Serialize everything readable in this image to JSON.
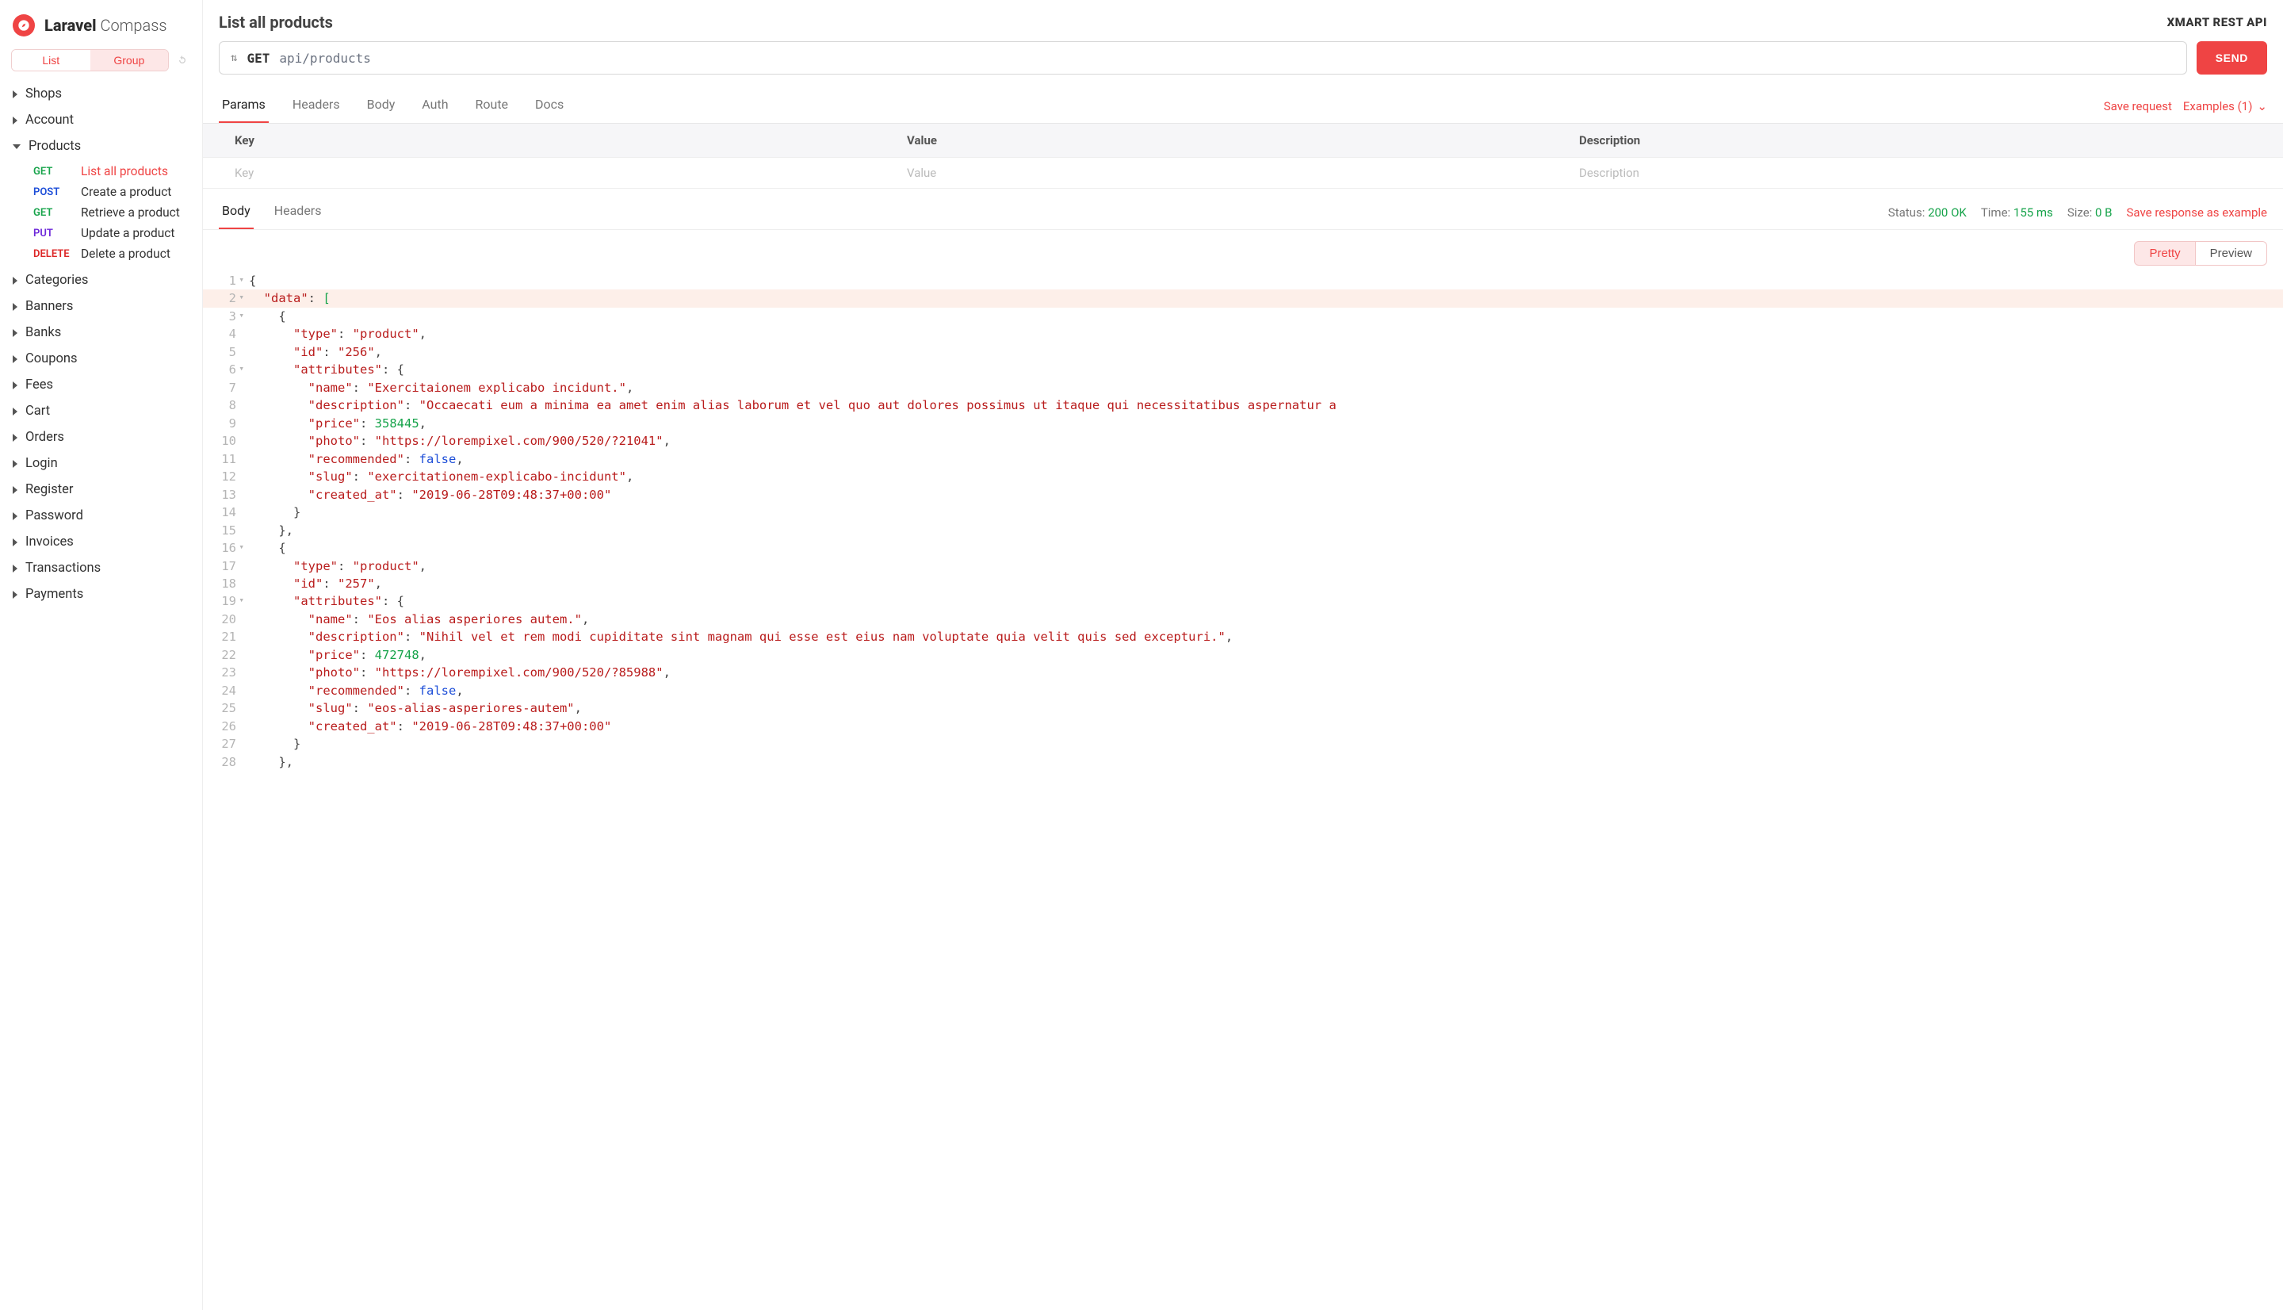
{
  "brand": {
    "bold": "Laravel",
    "light": "Compass"
  },
  "sidebarToggle": {
    "list": "List",
    "group": "Group"
  },
  "sidebar": {
    "groups": [
      {
        "label": "Shops",
        "expanded": false
      },
      {
        "label": "Account",
        "expanded": false
      },
      {
        "label": "Products",
        "expanded": true,
        "items": [
          {
            "method": "GET",
            "label": "List all products",
            "active": true
          },
          {
            "method": "POST",
            "label": "Create a product",
            "active": false
          },
          {
            "method": "GET",
            "label": "Retrieve a product",
            "active": false
          },
          {
            "method": "PUT",
            "label": "Update a product",
            "active": false
          },
          {
            "method": "DELETE",
            "label": "Delete a product",
            "active": false
          }
        ]
      },
      {
        "label": "Categories",
        "expanded": false
      },
      {
        "label": "Banners",
        "expanded": false
      },
      {
        "label": "Banks",
        "expanded": false
      },
      {
        "label": "Coupons",
        "expanded": false
      },
      {
        "label": "Fees",
        "expanded": false
      },
      {
        "label": "Cart",
        "expanded": false
      },
      {
        "label": "Orders",
        "expanded": false
      },
      {
        "label": "Login",
        "expanded": false
      },
      {
        "label": "Register",
        "expanded": false
      },
      {
        "label": "Password",
        "expanded": false
      },
      {
        "label": "Invoices",
        "expanded": false
      },
      {
        "label": "Transactions",
        "expanded": false
      },
      {
        "label": "Payments",
        "expanded": false
      }
    ]
  },
  "page": {
    "title": "List all products",
    "apiName": "XMART REST API"
  },
  "request": {
    "method": "GET",
    "url": "api/products",
    "send": "SEND"
  },
  "reqTabs": {
    "items": [
      "Params",
      "Headers",
      "Body",
      "Auth",
      "Route",
      "Docs"
    ],
    "active": "Params",
    "save": "Save request",
    "examples": "Examples (1)"
  },
  "kv": {
    "headers": {
      "key": "Key",
      "value": "Value",
      "desc": "Description"
    },
    "placeholders": {
      "key": "Key",
      "value": "Value",
      "desc": "Description"
    }
  },
  "respTabs": {
    "items": [
      "Body",
      "Headers"
    ],
    "active": "Body"
  },
  "respMeta": {
    "statusLabel": "Status:",
    "statusValue": "200 OK",
    "timeLabel": "Time:",
    "timeValue": "155 ms",
    "sizeLabel": "Size:",
    "sizeValue": "0 B",
    "save": "Save response as example"
  },
  "viewToggles": {
    "pretty": "Pretty",
    "preview": "Preview"
  },
  "json": {
    "lines": [
      {
        "n": 1,
        "fold": true,
        "indent": 0,
        "parts": [
          {
            "t": "brace",
            "v": "{"
          }
        ]
      },
      {
        "n": 2,
        "fold": true,
        "indent": 1,
        "hl": true,
        "parts": [
          {
            "t": "key",
            "v": "\"data\""
          },
          {
            "t": "colon",
            "v": ": "
          },
          {
            "t": "data",
            "v": "["
          }
        ]
      },
      {
        "n": 3,
        "fold": true,
        "indent": 2,
        "parts": [
          {
            "t": "brace",
            "v": "{"
          }
        ]
      },
      {
        "n": 4,
        "fold": false,
        "indent": 3,
        "parts": [
          {
            "t": "key",
            "v": "\"type\""
          },
          {
            "t": "colon",
            "v": ": "
          },
          {
            "t": "str",
            "v": "\"product\""
          },
          {
            "t": "punc",
            "v": ","
          }
        ]
      },
      {
        "n": 5,
        "fold": false,
        "indent": 3,
        "parts": [
          {
            "t": "key",
            "v": "\"id\""
          },
          {
            "t": "colon",
            "v": ": "
          },
          {
            "t": "str",
            "v": "\"256\""
          },
          {
            "t": "punc",
            "v": ","
          }
        ]
      },
      {
        "n": 6,
        "fold": true,
        "indent": 3,
        "parts": [
          {
            "t": "key",
            "v": "\"attributes\""
          },
          {
            "t": "colon",
            "v": ": "
          },
          {
            "t": "brace",
            "v": "{"
          }
        ]
      },
      {
        "n": 7,
        "fold": false,
        "indent": 4,
        "parts": [
          {
            "t": "key",
            "v": "\"name\""
          },
          {
            "t": "colon",
            "v": ": "
          },
          {
            "t": "str",
            "v": "\"Exercitaionem explicabo incidunt.\""
          },
          {
            "t": "punc",
            "v": ","
          }
        ]
      },
      {
        "n": 8,
        "fold": false,
        "indent": 4,
        "parts": [
          {
            "t": "key",
            "v": "\"description\""
          },
          {
            "t": "colon",
            "v": ": "
          },
          {
            "t": "str",
            "v": "\"Occaecati eum a minima ea amet enim alias laborum et vel quo aut dolores possimus ut itaque qui necessitatibus aspernatur a"
          }
        ]
      },
      {
        "n": 9,
        "fold": false,
        "indent": 4,
        "parts": [
          {
            "t": "key",
            "v": "\"price\""
          },
          {
            "t": "colon",
            "v": ": "
          },
          {
            "t": "num",
            "v": "358445"
          },
          {
            "t": "punc",
            "v": ","
          }
        ]
      },
      {
        "n": 10,
        "fold": false,
        "indent": 4,
        "parts": [
          {
            "t": "key",
            "v": "\"photo\""
          },
          {
            "t": "colon",
            "v": ": "
          },
          {
            "t": "str",
            "v": "\"https://lorempixel.com/900/520/?21041\""
          },
          {
            "t": "punc",
            "v": ","
          }
        ]
      },
      {
        "n": 11,
        "fold": false,
        "indent": 4,
        "parts": [
          {
            "t": "key",
            "v": "\"recommended\""
          },
          {
            "t": "colon",
            "v": ": "
          },
          {
            "t": "kw",
            "v": "false"
          },
          {
            "t": "punc",
            "v": ","
          }
        ]
      },
      {
        "n": 12,
        "fold": false,
        "indent": 4,
        "parts": [
          {
            "t": "key",
            "v": "\"slug\""
          },
          {
            "t": "colon",
            "v": ": "
          },
          {
            "t": "str",
            "v": "\"exercitationem-explicabo-incidunt\""
          },
          {
            "t": "punc",
            "v": ","
          }
        ]
      },
      {
        "n": 13,
        "fold": false,
        "indent": 4,
        "parts": [
          {
            "t": "key",
            "v": "\"created_at\""
          },
          {
            "t": "colon",
            "v": ": "
          },
          {
            "t": "str",
            "v": "\"2019-06-28T09:48:37+00:00\""
          }
        ]
      },
      {
        "n": 14,
        "fold": false,
        "indent": 3,
        "parts": [
          {
            "t": "brace",
            "v": "}"
          }
        ]
      },
      {
        "n": 15,
        "fold": false,
        "indent": 2,
        "parts": [
          {
            "t": "brace",
            "v": "},"
          }
        ]
      },
      {
        "n": 16,
        "fold": true,
        "indent": 2,
        "parts": [
          {
            "t": "brace",
            "v": "{"
          }
        ]
      },
      {
        "n": 17,
        "fold": false,
        "indent": 3,
        "parts": [
          {
            "t": "key",
            "v": "\"type\""
          },
          {
            "t": "colon",
            "v": ": "
          },
          {
            "t": "str",
            "v": "\"product\""
          },
          {
            "t": "punc",
            "v": ","
          }
        ]
      },
      {
        "n": 18,
        "fold": false,
        "indent": 3,
        "parts": [
          {
            "t": "key",
            "v": "\"id\""
          },
          {
            "t": "colon",
            "v": ": "
          },
          {
            "t": "str",
            "v": "\"257\""
          },
          {
            "t": "punc",
            "v": ","
          }
        ]
      },
      {
        "n": 19,
        "fold": true,
        "indent": 3,
        "parts": [
          {
            "t": "key",
            "v": "\"attributes\""
          },
          {
            "t": "colon",
            "v": ": "
          },
          {
            "t": "brace",
            "v": "{"
          }
        ]
      },
      {
        "n": 20,
        "fold": false,
        "indent": 4,
        "parts": [
          {
            "t": "key",
            "v": "\"name\""
          },
          {
            "t": "colon",
            "v": ": "
          },
          {
            "t": "str",
            "v": "\"Eos alias asperiores autem.\""
          },
          {
            "t": "punc",
            "v": ","
          }
        ]
      },
      {
        "n": 21,
        "fold": false,
        "indent": 4,
        "parts": [
          {
            "t": "key",
            "v": "\"description\""
          },
          {
            "t": "colon",
            "v": ": "
          },
          {
            "t": "str",
            "v": "\"Nihil vel et rem modi cupiditate sint magnam qui esse est eius nam voluptate quia velit quis sed excepturi.\""
          },
          {
            "t": "punc",
            "v": ","
          }
        ]
      },
      {
        "n": 22,
        "fold": false,
        "indent": 4,
        "parts": [
          {
            "t": "key",
            "v": "\"price\""
          },
          {
            "t": "colon",
            "v": ": "
          },
          {
            "t": "num",
            "v": "472748"
          },
          {
            "t": "punc",
            "v": ","
          }
        ]
      },
      {
        "n": 23,
        "fold": false,
        "indent": 4,
        "parts": [
          {
            "t": "key",
            "v": "\"photo\""
          },
          {
            "t": "colon",
            "v": ": "
          },
          {
            "t": "str",
            "v": "\"https://lorempixel.com/900/520/?85988\""
          },
          {
            "t": "punc",
            "v": ","
          }
        ]
      },
      {
        "n": 24,
        "fold": false,
        "indent": 4,
        "parts": [
          {
            "t": "key",
            "v": "\"recommended\""
          },
          {
            "t": "colon",
            "v": ": "
          },
          {
            "t": "kw",
            "v": "false"
          },
          {
            "t": "punc",
            "v": ","
          }
        ]
      },
      {
        "n": 25,
        "fold": false,
        "indent": 4,
        "parts": [
          {
            "t": "key",
            "v": "\"slug\""
          },
          {
            "t": "colon",
            "v": ": "
          },
          {
            "t": "str",
            "v": "\"eos-alias-asperiores-autem\""
          },
          {
            "t": "punc",
            "v": ","
          }
        ]
      },
      {
        "n": 26,
        "fold": false,
        "indent": 4,
        "parts": [
          {
            "t": "key",
            "v": "\"created_at\""
          },
          {
            "t": "colon",
            "v": ": "
          },
          {
            "t": "str",
            "v": "\"2019-06-28T09:48:37+00:00\""
          }
        ]
      },
      {
        "n": 27,
        "fold": false,
        "indent": 3,
        "parts": [
          {
            "t": "brace",
            "v": "}"
          }
        ]
      },
      {
        "n": 28,
        "fold": false,
        "indent": 2,
        "parts": [
          {
            "t": "brace",
            "v": "},"
          }
        ]
      }
    ]
  }
}
